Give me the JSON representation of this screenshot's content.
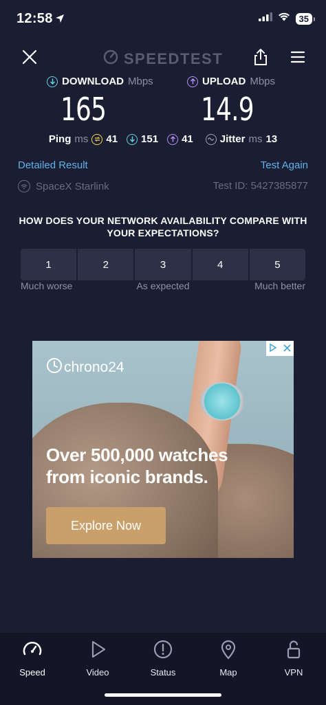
{
  "status": {
    "time": "12:58",
    "battery": "35"
  },
  "header": {
    "logo": "SPEEDTEST"
  },
  "download": {
    "label": "DOWNLOAD",
    "unit": "Mbps",
    "value": "165"
  },
  "upload": {
    "label": "UPLOAD",
    "unit": "Mbps",
    "value": "14.9"
  },
  "ping": {
    "label": "Ping",
    "unit": "ms",
    "idle": "41",
    "down": "151",
    "up": "41"
  },
  "jitter": {
    "label": "Jitter",
    "unit": "ms",
    "value": "13"
  },
  "result": {
    "detailed_link": "Detailed Result",
    "again_link": "Test Again",
    "provider": "SpaceX Starlink",
    "test_id": "Test ID: 5427385877"
  },
  "survey": {
    "question": "HOW DOES YOUR NETWORK AVAILABILITY COMPARE WITH YOUR EXPECTATIONS?",
    "options": [
      "1",
      "2",
      "3",
      "4",
      "5"
    ],
    "low_label": "Much worse",
    "mid_label": "As expected",
    "high_label": "Much better"
  },
  "ad": {
    "brand": "chrono24",
    "headline_line1": "Over 500,000 watches",
    "headline_line2": "from iconic brands.",
    "cta": "Explore Now"
  },
  "tabs": [
    {
      "label": "Speed",
      "icon": "speedometer-icon"
    },
    {
      "label": "Video",
      "icon": "play-icon"
    },
    {
      "label": "Status",
      "icon": "alert-icon"
    },
    {
      "label": "Map",
      "icon": "map-pin-icon"
    },
    {
      "label": "VPN",
      "icon": "lock-icon"
    }
  ],
  "colors": {
    "background": "#1b1d33",
    "download_accent": "#5fd0e0",
    "upload_accent": "#b58cf5",
    "link": "#5fb3ea",
    "ping_accent": "#f2d94e"
  }
}
